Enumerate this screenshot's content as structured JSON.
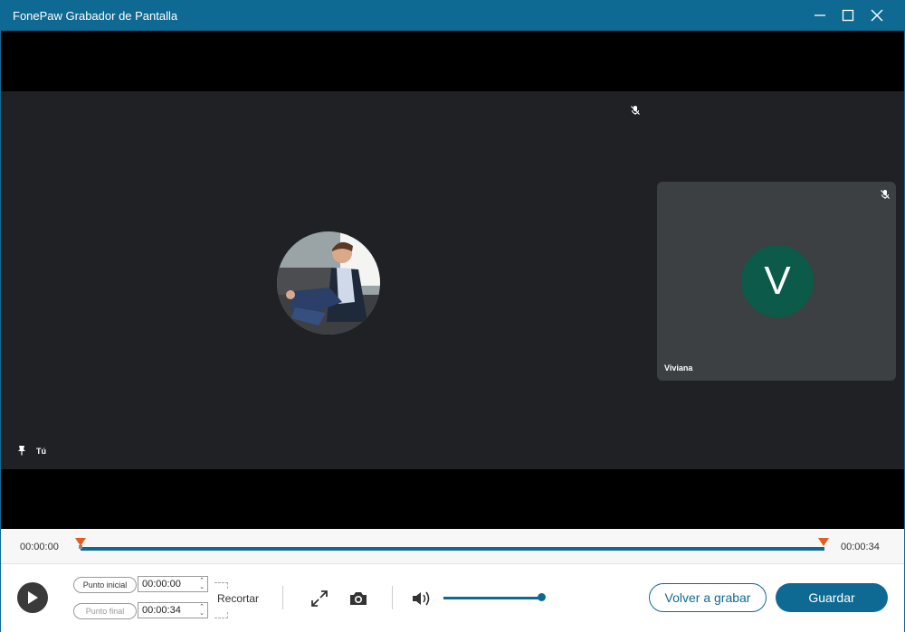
{
  "window": {
    "title": "FonePaw Grabador de Pantalla"
  },
  "meeting": {
    "self_label": "Tú",
    "participant": {
      "name": "Viviana",
      "initial": "V",
      "color": "#0b5a4a"
    }
  },
  "timeline": {
    "start": "00:00:00",
    "end": "00:00:34",
    "progress": 1.0
  },
  "trim": {
    "start_label": "Punto inicial",
    "start_value": "00:00:00",
    "end_label": "Punto final",
    "end_value": "00:00:34",
    "trim_label": "Recortar"
  },
  "volume": {
    "level": 1.0
  },
  "actions": {
    "rerecord_label": "Volver a grabar",
    "save_label": "Guardar"
  },
  "colors": {
    "accent": "#0f6a93",
    "marker": "#e35e21"
  }
}
